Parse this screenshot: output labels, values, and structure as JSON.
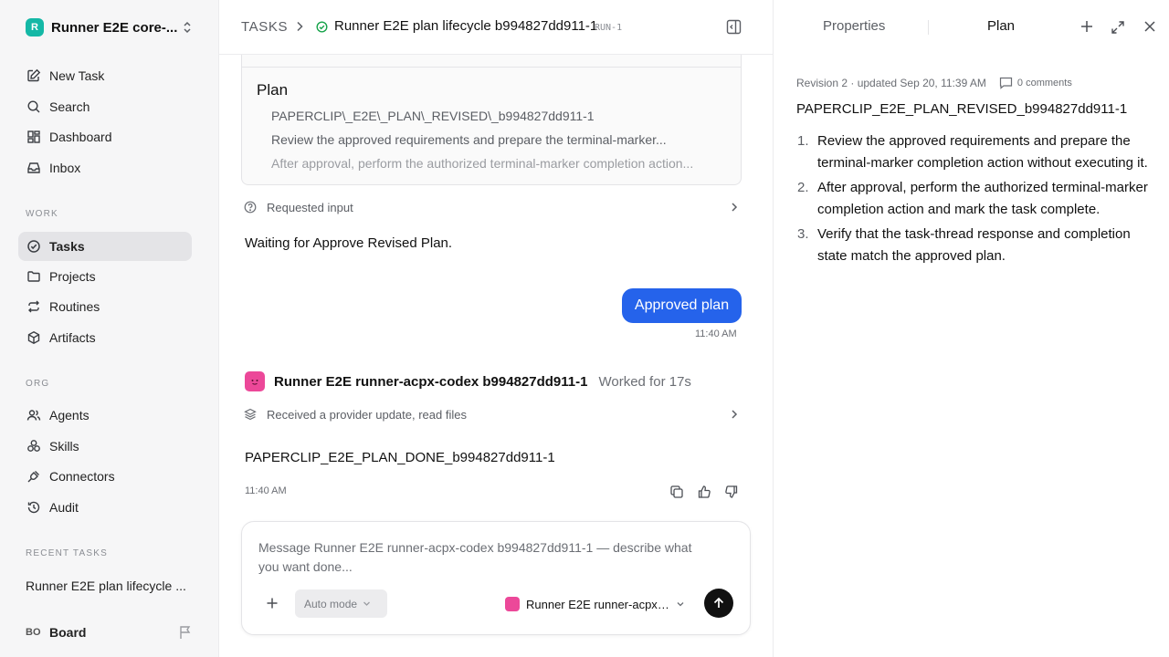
{
  "sidebar": {
    "workspace": {
      "logo": "R",
      "name": "Runner E2E core-..."
    },
    "nav_top": [
      {
        "label": "New Task",
        "icon": "edit-icon"
      },
      {
        "label": "Search",
        "icon": "search-icon"
      },
      {
        "label": "Dashboard",
        "icon": "dashboard-icon"
      },
      {
        "label": "Inbox",
        "icon": "inbox-icon"
      }
    ],
    "work_label": "WORK",
    "work_items": [
      {
        "label": "Tasks",
        "icon": "check-circle-icon",
        "active": true
      },
      {
        "label": "Projects",
        "icon": "folder-icon"
      },
      {
        "label": "Routines",
        "icon": "repeat-icon"
      },
      {
        "label": "Artifacts",
        "icon": "cube-icon"
      }
    ],
    "org_label": "ORG",
    "org_items": [
      {
        "label": "Agents",
        "icon": "users-icon"
      },
      {
        "label": "Skills",
        "icon": "skills-icon"
      },
      {
        "label": "Connectors",
        "icon": "plug-icon"
      },
      {
        "label": "Audit",
        "icon": "history-icon"
      }
    ],
    "recent_label": "RECENT TASKS",
    "recent_task": "Runner E2E plan lifecycle ...",
    "board": {
      "initials": "BO",
      "label": "Board"
    }
  },
  "header": {
    "crumb_root": "TASKS",
    "title": "Runner E2E plan lifecycle b994827dd911-1",
    "run_id": "RUN-1"
  },
  "plan_card": {
    "title": "Plan",
    "items": [
      "PAPERCLIP\\_E2E\\_PLAN\\_REVISED\\_b994827dd911-1",
      "Review the approved requirements and prepare the terminal-marker...",
      "After approval, perform the authorized terminal-marker completion action..."
    ]
  },
  "thread": {
    "requested_input": "Requested input",
    "waiting": "Waiting for Approve Revised Plan.",
    "user_message": "Approved plan",
    "user_time": "11:40 AM",
    "agent_name": "Runner E2E runner-acpx-codex b994827dd911-1",
    "worked": "Worked for 17s",
    "provider_update": "Received a provider update, read files",
    "agent_reply": "PAPERCLIP_E2E_PLAN_DONE_b994827dd911-1",
    "reply_time": "11:40 AM"
  },
  "composer": {
    "placeholder": "Message Runner E2E runner-acpx-codex b994827dd911-1 — describe what you want done...",
    "mode": "Auto mode",
    "agent": "Runner E2E runner-acpx-..."
  },
  "right_panel": {
    "tab_properties": "Properties",
    "tab_plan": "Plan",
    "revision": "Revision 2 · updated Sep 20, 11:39 AM",
    "comments": "0 comments",
    "plan_title": "PAPERCLIP_E2E_PLAN_REVISED_b994827dd911-1",
    "steps": [
      {
        "num": "1.",
        "text": "Review the approved requirements and prepare the terminal-marker completion action without executing it."
      },
      {
        "num": "2.",
        "text": "After approval, perform the authorized terminal-marker completion action and mark the task complete."
      },
      {
        "num": "3.",
        "text": "Verify that the task-thread response and completion state match the approved plan."
      }
    ]
  },
  "colors": {
    "accent": "#2563eb",
    "status_ok": "#16a34a",
    "avatar": "#ec4899",
    "logo": "#14b8a6"
  }
}
